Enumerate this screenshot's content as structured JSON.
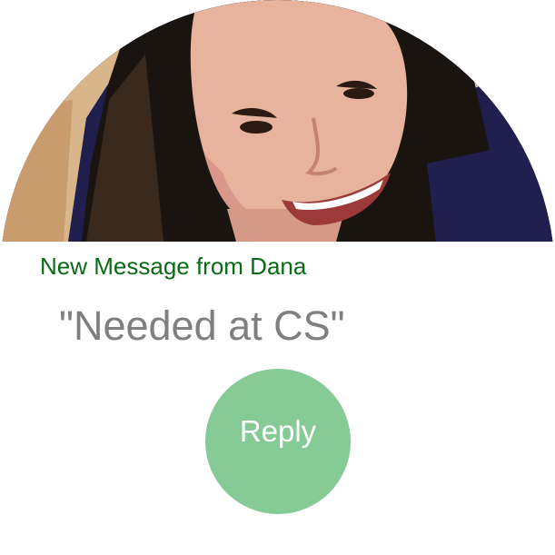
{
  "notification": {
    "title": "New Message from Dana",
    "message": "\"Needed at CS\"",
    "reply_label": "Reply",
    "sender_photo": "sender-avatar-photo"
  },
  "colors": {
    "title": "#0a6b14",
    "message": "#7f7f7f",
    "reply_button": "#86cb96",
    "reply_text": "#ffffff",
    "photo_background": "#201f4e"
  }
}
